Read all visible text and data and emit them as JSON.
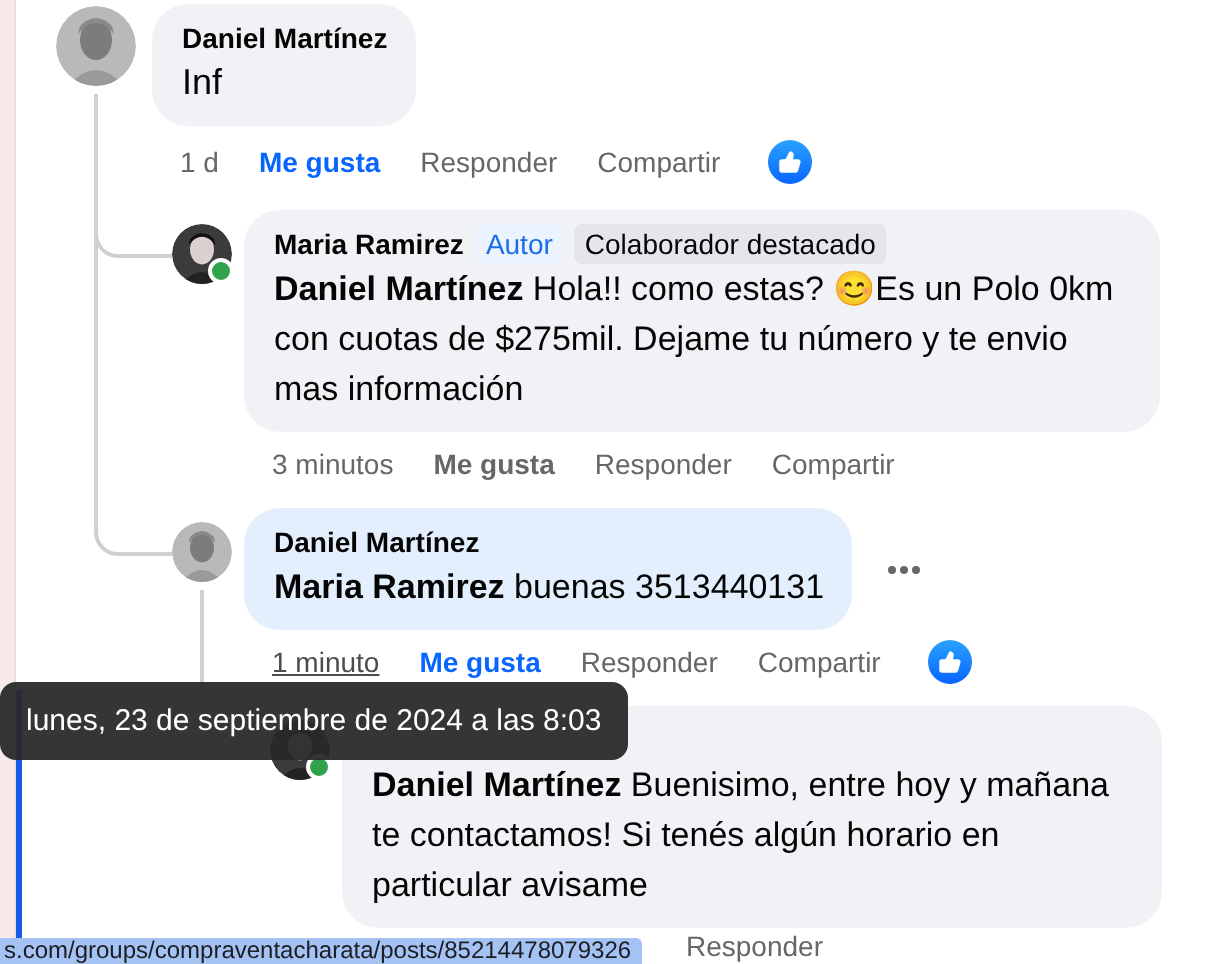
{
  "comments": [
    {
      "author": "Daniel Martínez",
      "highlighted": false,
      "text": "Inf",
      "actions": [
        {
          "kind": "time",
          "label": "1 d",
          "hovered": false
        },
        {
          "kind": "like",
          "label": "Me gusta",
          "selected": true
        },
        {
          "kind": "reply",
          "label": "Responder"
        },
        {
          "kind": "share",
          "label": "Compartir"
        }
      ],
      "reaction": {
        "kind": "like"
      },
      "children": [
        {
          "author": "Maria Ramirez",
          "online": true,
          "highlighted": false,
          "badges": [
            {
              "label": "Autor",
              "kind": "author"
            },
            {
              "label": "Colaborador destacado",
              "kind": "contributor"
            }
          ],
          "text": "**Daniel Martínez** Hola!! como estas? 😊Es un Polo 0km con cuotas de $275mil. Dejame tu número y te envio mas información",
          "actions": [
            {
              "kind": "time",
              "label": "3 minutos",
              "hovered": false
            },
            {
              "kind": "like",
              "label": "Me gusta",
              "selected": false
            },
            {
              "kind": "reply",
              "label": "Responder"
            },
            {
              "kind": "share",
              "label": "Compartir"
            }
          ]
        },
        {
          "author": "Daniel Martínez",
          "highlighted": true,
          "text": "**Maria Ramirez** buenas 3513440131",
          "more_menu": true,
          "actions": [
            {
              "kind": "time",
              "label": "1 minuto",
              "hovered": true
            },
            {
              "kind": "like",
              "label": "Me gusta",
              "selected": true
            },
            {
              "kind": "reply",
              "label": "Responder"
            },
            {
              "kind": "share",
              "label": "Compartir"
            }
          ],
          "reaction": {
            "kind": "like"
          },
          "children": [
            {
              "online": true,
              "highlighted": false,
              "text": "**Daniel Martínez** Buenisimo, entre hoy y mañana te contactamos! Si tenés algún horario en particular avisame",
              "actions": [
                {
                  "kind": "reply",
                  "label": "Responder"
                }
              ]
            }
          ]
        }
      ]
    }
  ],
  "tooltip": {
    "text": "lunes, 23 de septiembre de 2024 a las 8:03"
  },
  "status_bar": {
    "url": "s.com/groups/compraventacharata/posts/85214478079326"
  }
}
